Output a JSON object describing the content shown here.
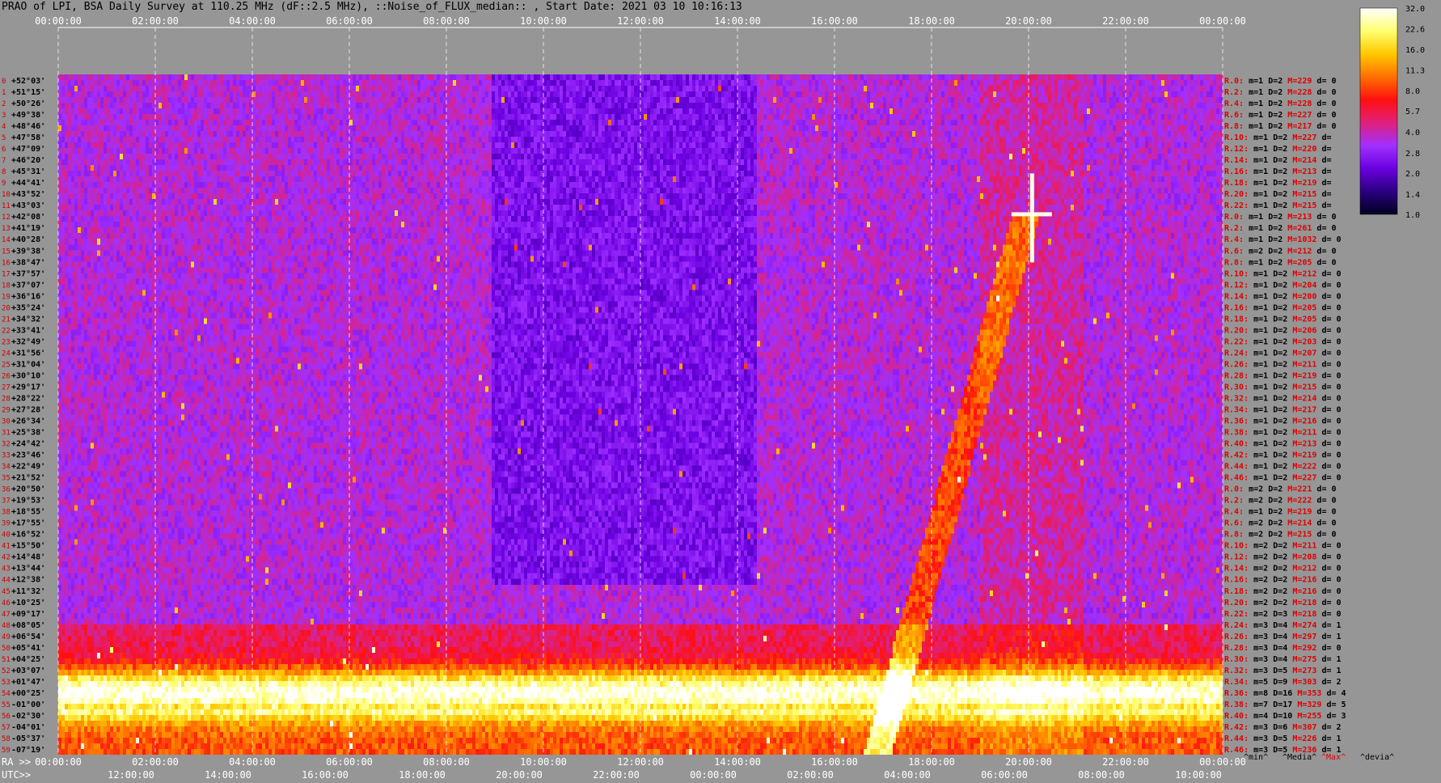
{
  "header": {
    "title": "PRAO of LPI, BSA Daily Survey at 110.25 MHz (dF::2.5 MHz), ::Noise_of_FLUX_median:: , Start Date: 2021 03 10 10:16:13"
  },
  "chart_data": {
    "type": "heatmap",
    "title": "PRAO of LPI, BSA Daily Survey at 110.25 MHz (dF::2.5 MHz), ::Noise_of_FLUX_median:: , Start Date: 2021 03 10 10:16:13",
    "top_ticks": [
      "00:00:00",
      "02:00:00",
      "04:00:00",
      "06:00:00",
      "08:00:00",
      "10:00:00",
      "12:00:00",
      "14:00:00",
      "16:00:00",
      "18:00:00",
      "20:00:00",
      "22:00:00",
      "00:00:00"
    ],
    "ra_label": "RA >>",
    "utc_label": "UTC>>",
    "ra_ticks": [
      "00:00:00",
      "02:00:00",
      "04:00:00",
      "06:00:00",
      "08:00:00",
      "10:00:00",
      "12:00:00",
      "14:00:00",
      "16:00:00",
      "18:00:00",
      "20:00:00",
      "22:00:00",
      "00:00:00"
    ],
    "utc_ticks": [
      "12:00:00",
      "14:00:00",
      "16:00:00",
      "18:00:00",
      "20:00:00",
      "22:00:00",
      "00:00:00",
      "02:00:00",
      "04:00:00",
      "06:00:00",
      "08:00:00",
      "10:00:00"
    ],
    "dec_labels": [
      "+52°03'",
      "+51°15'",
      "+50°26'",
      "+49°38'",
      "+48°46'",
      "+47°58'",
      "+47°09'",
      "+46°20'",
      "+45°31'",
      "+44°41'",
      "+43°52'",
      "+43°03'",
      "+42°08'",
      "+41°19'",
      "+40°28'",
      "+39°38'",
      "+38°47'",
      "+37°57'",
      "+37°07'",
      "+36°16'",
      "+35°24'",
      "+34°32'",
      "+33°41'",
      "+32°49'",
      "+31°56'",
      "+31°04'",
      "+30°10'",
      "+29°17'",
      "+28°22'",
      "+27°28'",
      "+26°34'",
      "+25°38'",
      "+24°42'",
      "+23°46'",
      "+22°49'",
      "+21°52'",
      "+20°50'",
      "+19°53'",
      "+18°55'",
      "+17°55'",
      "+16°52'",
      "+15°50'",
      "+14°48'",
      "+13°44'",
      "+12°38'",
      "+11°32'",
      "+10°25'",
      "+09°17'",
      "+08°05'",
      "+06°54'",
      "+05°41'",
      "+04°25'",
      "+03°07'",
      "+01°47'",
      "+00°25'",
      "-01°00'",
      "-02°30'",
      "-04°01'",
      "-05°37'",
      "-07°19'"
    ],
    "row_stats": [
      {
        "r": "R.0:",
        "m": "1",
        "D": "2",
        "M": "229",
        "d": "0"
      },
      {
        "r": "R.2:",
        "m": "1",
        "D": "2",
        "M": "228",
        "d": "0"
      },
      {
        "r": "R.4:",
        "m": "1",
        "D": "2",
        "M": "228",
        "d": "0"
      },
      {
        "r": "R.6:",
        "m": "1",
        "D": "2",
        "M": "227",
        "d": "0"
      },
      {
        "r": "R.8:",
        "m": "1",
        "D": "2",
        "M": "217",
        "d": "0"
      },
      {
        "r": "R.10:",
        "m": "1",
        "D": "2",
        "M": "227",
        "d": ""
      },
      {
        "r": "R.12:",
        "m": "1",
        "D": "2",
        "M": "220",
        "d": ""
      },
      {
        "r": "R.14:",
        "m": "1",
        "D": "2",
        "M": "214",
        "d": ""
      },
      {
        "r": "R.16:",
        "m": "1",
        "D": "2",
        "M": "213",
        "d": ""
      },
      {
        "r": "R.18:",
        "m": "1",
        "D": "2",
        "M": "219",
        "d": ""
      },
      {
        "r": "R.20:",
        "m": "1",
        "D": "2",
        "M": "215",
        "d": ""
      },
      {
        "r": "R.22:",
        "m": "1",
        "D": "2",
        "M": "215",
        "d": ""
      },
      {
        "r": "R.0:",
        "m": "1",
        "D": "2",
        "M": "213",
        "d": "0"
      },
      {
        "r": "R.2:",
        "m": "1",
        "D": "2",
        "M": "261",
        "d": "0"
      },
      {
        "r": "R.4:",
        "m": "1",
        "D": "2",
        "M": "1032",
        "d": "0"
      },
      {
        "r": "R.6:",
        "m": "2",
        "D": "2",
        "M": "212",
        "d": "0"
      },
      {
        "r": "R.8:",
        "m": "1",
        "D": "2",
        "M": "205",
        "d": "0"
      },
      {
        "r": "R.10:",
        "m": "1",
        "D": "2",
        "M": "212",
        "d": "0"
      },
      {
        "r": "R.12:",
        "m": "1",
        "D": "2",
        "M": "204",
        "d": "0"
      },
      {
        "r": "R.14:",
        "m": "1",
        "D": "2",
        "M": "200",
        "d": "0"
      },
      {
        "r": "R.16:",
        "m": "1",
        "D": "2",
        "M": "205",
        "d": "0"
      },
      {
        "r": "R.18:",
        "m": "1",
        "D": "2",
        "M": "205",
        "d": "0"
      },
      {
        "r": "R.20:",
        "m": "1",
        "D": "2",
        "M": "206",
        "d": "0"
      },
      {
        "r": "R.22:",
        "m": "1",
        "D": "2",
        "M": "203",
        "d": "0"
      },
      {
        "r": "R.24:",
        "m": "1",
        "D": "2",
        "M": "207",
        "d": "0"
      },
      {
        "r": "R.26:",
        "m": "1",
        "D": "2",
        "M": "211",
        "d": "0"
      },
      {
        "r": "R.28:",
        "m": "1",
        "D": "2",
        "M": "219",
        "d": "0"
      },
      {
        "r": "R.30:",
        "m": "1",
        "D": "2",
        "M": "215",
        "d": "0"
      },
      {
        "r": "R.32:",
        "m": "1",
        "D": "2",
        "M": "214",
        "d": "0"
      },
      {
        "r": "R.34:",
        "m": "1",
        "D": "2",
        "M": "217",
        "d": "0"
      },
      {
        "r": "R.36:",
        "m": "1",
        "D": "2",
        "M": "216",
        "d": "0"
      },
      {
        "r": "R.38:",
        "m": "1",
        "D": "2",
        "M": "211",
        "d": "0"
      },
      {
        "r": "R.40:",
        "m": "1",
        "D": "2",
        "M": "213",
        "d": "0"
      },
      {
        "r": "R.42:",
        "m": "1",
        "D": "2",
        "M": "219",
        "d": "0"
      },
      {
        "r": "R.44:",
        "m": "1",
        "D": "2",
        "M": "222",
        "d": "0"
      },
      {
        "r": "R.46:",
        "m": "1",
        "D": "2",
        "M": "227",
        "d": "0"
      },
      {
        "r": "R.0:",
        "m": "2",
        "D": "2",
        "M": "221",
        "d": "0"
      },
      {
        "r": "R.2:",
        "m": "2",
        "D": "2",
        "M": "222",
        "d": "0"
      },
      {
        "r": "R.4:",
        "m": "1",
        "D": "2",
        "M": "219",
        "d": "0"
      },
      {
        "r": "R.6:",
        "m": "2",
        "D": "2",
        "M": "214",
        "d": "0"
      },
      {
        "r": "R.8:",
        "m": "2",
        "D": "2",
        "M": "215",
        "d": "0"
      },
      {
        "r": "R.10:",
        "m": "2",
        "D": "2",
        "M": "211",
        "d": "0"
      },
      {
        "r": "R.12:",
        "m": "2",
        "D": "2",
        "M": "208",
        "d": "0"
      },
      {
        "r": "R.14:",
        "m": "2",
        "D": "2",
        "M": "212",
        "d": "0"
      },
      {
        "r": "R.16:",
        "m": "2",
        "D": "2",
        "M": "216",
        "d": "0"
      },
      {
        "r": "R.18:",
        "m": "2",
        "D": "2",
        "M": "216",
        "d": "0"
      },
      {
        "r": "R.20:",
        "m": "2",
        "D": "2",
        "M": "218",
        "d": "0"
      },
      {
        "r": "R.22:",
        "m": "2",
        "D": "3",
        "M": "218",
        "d": "0"
      },
      {
        "r": "R.24:",
        "m": "3",
        "D": "4",
        "M": "274",
        "d": "1"
      },
      {
        "r": "R.26:",
        "m": "3",
        "D": "4",
        "M": "297",
        "d": "1"
      },
      {
        "r": "R.28:",
        "m": "3",
        "D": "4",
        "M": "292",
        "d": "0"
      },
      {
        "r": "R.30:",
        "m": "3",
        "D": "4",
        "M": "275",
        "d": "1"
      },
      {
        "r": "R.32:",
        "m": "3",
        "D": "5",
        "M": "273",
        "d": "1"
      },
      {
        "r": "R.34:",
        "m": "5",
        "D": "9",
        "M": "303",
        "d": "2"
      },
      {
        "r": "R.36:",
        "m": "8",
        "D": "16",
        "M": "353",
        "d": "4"
      },
      {
        "r": "R.38:",
        "m": "7",
        "D": "17",
        "M": "329",
        "d": "5"
      },
      {
        "r": "R.40:",
        "m": "4",
        "D": "10",
        "M": "255",
        "d": "3"
      },
      {
        "r": "R.42:",
        "m": "3",
        "D": "6",
        "M": "307",
        "d": "2"
      },
      {
        "r": "R.44:",
        "m": "3",
        "D": "5",
        "M": "226",
        "d": "1"
      },
      {
        "r": "R.46:",
        "m": "3",
        "D": "5",
        "M": "236",
        "d": "1"
      }
    ],
    "stat_footer": [
      "^min^",
      "^Media^",
      "^Max^",
      "^devia^"
    ],
    "colorbar": {
      "ticks": [
        "32.0",
        "22.6",
        "16.0",
        "11.3",
        "8.0",
        "5.7",
        "4.0",
        "2.8",
        "2.0",
        "1.4",
        "1.0"
      ],
      "scale": "log",
      "range": [
        1.0,
        32.0
      ],
      "colors": [
        "#000020",
        "#2a0080",
        "#6b00e0",
        "#a030ff",
        "#e0207a",
        "#ff1010",
        "#ff7000",
        "#ffc800",
        "#ffff70",
        "#ffffff"
      ]
    },
    "features": {
      "gal_plane_band_dec": [
        "+03°07'",
        "-02°30'"
      ],
      "bright_source_utc": "06:00:00",
      "bright_source_dec": "+41°19'"
    }
  }
}
